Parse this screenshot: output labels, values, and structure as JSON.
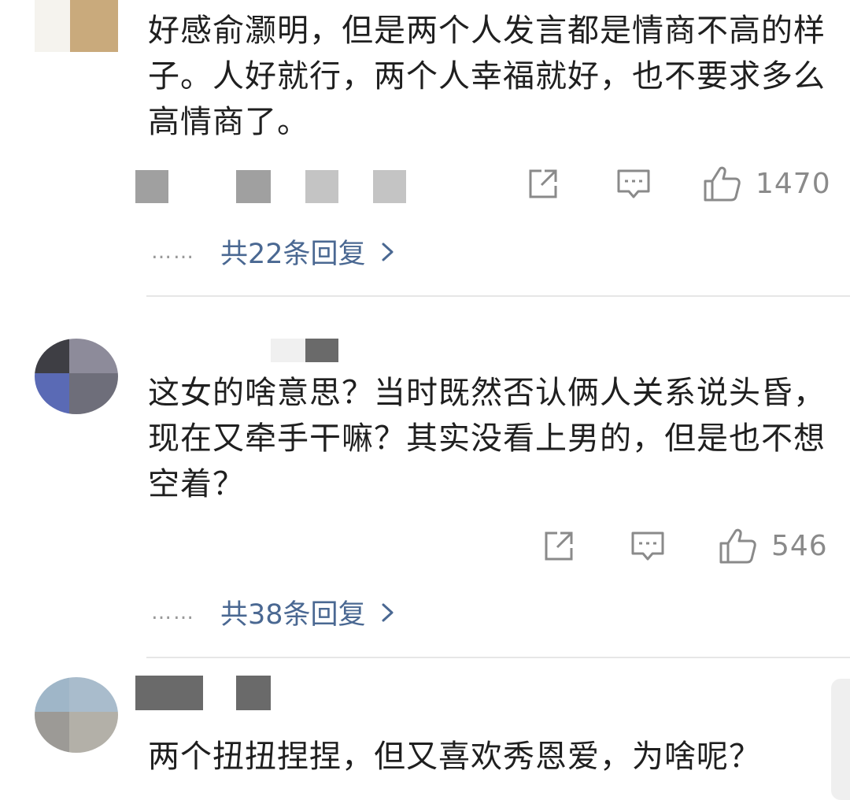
{
  "comments": [
    {
      "text": "好感俞灏明，但是两个人发言都是情商不高的样子。人好就行，两个人幸福就好，也不要求多么高情商了。",
      "likes": "1470",
      "replies_label": "共22条回复",
      "dots": "……"
    },
    {
      "text": "这女的啥意思？当时既然否认俩人关系说头昏，现在又牵手干嘛？其实没看上男的，但是也不想空着？",
      "likes": "546",
      "replies_label": "共38条回复",
      "dots": "……"
    },
    {
      "text": "两个扭扭捏捏，但又喜欢秀恩爱，为啥呢？"
    }
  ],
  "colors": {
    "reply_link": "#4a6892",
    "icon_gray": "#8a8a8a",
    "text": "#1f1f1f"
  },
  "icons": [
    "share-icon",
    "comment-icon",
    "like-icon",
    "chevron-right-icon"
  ]
}
